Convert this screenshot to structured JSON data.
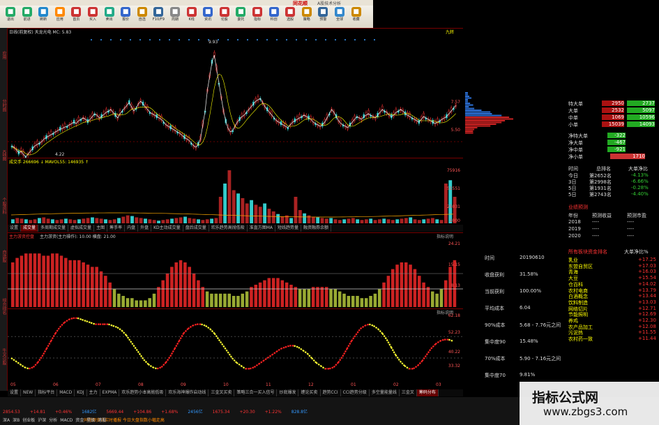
{
  "window": {
    "brand": "同花顺",
    "title": "A股技术分析"
  },
  "toolbar": [
    {
      "icon": "back",
      "label": "退出"
    },
    {
      "icon": "forward",
      "label": "前进"
    },
    {
      "icon": "refresh",
      "label": "刷新"
    },
    {
      "icon": "menu",
      "label": "应用"
    },
    {
      "icon": "home",
      "label": "首页"
    },
    {
      "icon": "buy",
      "label": "买入"
    },
    {
      "icon": "sell",
      "label": "卖出"
    },
    {
      "icon": "quote",
      "label": "报价"
    },
    {
      "icon": "chart",
      "label": "自选"
    },
    {
      "icon": "f10",
      "label": "F10/F9"
    },
    {
      "icon": "bookmark",
      "label": "周期"
    },
    {
      "icon": "kline",
      "label": "K线"
    },
    {
      "icon": "info",
      "label": "资讯"
    },
    {
      "icon": "news",
      "label": "论股"
    },
    {
      "icon": "trade",
      "label": "委托"
    },
    {
      "icon": "data",
      "label": "指标"
    },
    {
      "icon": "tech",
      "label": "科创"
    },
    {
      "icon": "filter",
      "label": "选股"
    },
    {
      "icon": "strategy",
      "label": "策略"
    },
    {
      "icon": "monitor",
      "label": "预警"
    },
    {
      "icon": "global",
      "label": "全球"
    },
    {
      "icon": "favorite",
      "label": "收藏"
    }
  ],
  "left_tabs": [
    "应用",
    "分时图",
    "K线图",
    "个股资料",
    "自选股",
    "综合排名",
    "牛叉诊股"
  ],
  "kline": {
    "header": "日线(前复权)  天龙光电  MC: 5.83",
    "high_label": "9.93",
    "low_label": "4.22",
    "y_labels": [
      "7.57",
      "5.50"
    ],
    "right_tag": "九转"
  },
  "volume": {
    "header": "成交手 266696 ↓  MAVOL55: 146935 ↑",
    "y_labels": [
      "75916",
      "51551",
      "25031",
      "1000"
    ]
  },
  "tabs1": [
    "设置",
    "成交量",
    "多周期成交量",
    "虚拟成交量",
    "主图",
    "筹手率",
    "内盘",
    "外盘",
    "KD主动成交量",
    "盘后成交量",
    "欢乐趋势高抛低吸",
    "准直方图MA",
    "短线趋势量",
    "融资融券余额"
  ],
  "tabs1_active": 1,
  "ind1": {
    "header_red": "主力游资控盘",
    "header_formula": "主力游资(主力操作): 10.00  横盘: 21.00",
    "right_label": "指标说明",
    "y_labels": [
      "24.21",
      "15.15",
      "8.13"
    ],
    "chart_data": {
      "type": "bar",
      "title": "主力游资控盘",
      "ylim": [
        0,
        30
      ],
      "threshold": 8.13,
      "values": [
        20,
        22,
        23,
        24,
        24,
        24,
        24,
        23,
        23,
        24,
        24,
        23,
        22,
        21,
        21,
        21,
        20,
        19,
        18,
        18,
        16,
        14,
        11,
        8,
        6,
        5,
        4,
        4,
        3,
        3,
        3,
        4,
        6,
        9,
        12,
        15,
        18,
        20,
        21,
        20,
        18,
        15,
        12,
        9,
        7,
        6,
        6,
        6,
        6,
        6,
        5,
        5,
        6,
        7,
        9,
        10,
        11,
        12,
        13,
        13,
        13,
        12,
        11,
        10,
        9,
        8,
        8,
        8,
        9,
        9,
        9,
        9,
        8,
        8,
        7,
        6,
        5,
        5,
        5,
        4,
        4,
        5,
        6,
        8,
        11,
        14,
        17,
        19,
        20,
        20,
        19,
        17,
        14,
        11,
        9,
        7,
        6,
        8,
        12,
        18,
        21
      ]
    }
  },
  "ind2": {
    "right_label": "指标说明",
    "y_labels": [
      "62.18",
      "52.23",
      "40.22",
      "33.32"
    ],
    "chart_data": {
      "type": "line",
      "title": "",
      "ylim": [
        25,
        70
      ],
      "values": [
        40,
        38,
        36,
        34,
        33,
        34,
        37,
        41,
        46,
        51,
        56,
        60,
        63,
        65,
        66,
        66,
        65,
        64,
        63,
        62,
        62,
        62,
        62,
        61,
        60,
        58,
        55,
        51,
        47,
        43,
        39,
        36,
        34,
        33,
        34,
        37,
        41,
        46,
        51,
        56,
        59,
        61,
        62,
        62,
        61,
        59,
        56,
        52,
        48,
        44,
        40,
        37,
        35,
        33,
        33,
        34,
        36,
        38,
        40,
        42,
        44,
        46,
        47,
        48,
        48,
        47,
        45,
        43,
        40,
        37,
        35,
        33,
        33,
        34,
        37,
        41,
        46,
        51,
        55,
        59,
        61,
        62,
        61,
        59,
        56,
        52,
        47,
        42,
        38,
        35,
        33,
        33,
        35,
        38,
        42,
        46,
        49,
        51,
        52,
        52,
        51
      ]
    }
  },
  "xaxis": [
    "05",
    "06",
    "07",
    "08",
    "09",
    "10",
    "11",
    "12",
    "01",
    "02",
    "03"
  ],
  "tabs2": [
    "设置",
    "NEW",
    "指标平台",
    "MACD",
    "KDJ",
    "主力",
    "EXPMA",
    "欢乐趋势小本高抛低吸",
    "欢乐海神爆炸启动线",
    "三金叉买卖",
    "策略三合一买入信号",
    "炒底爆发",
    "缠论买卖",
    "趋势CCI",
    "CCI趋势分级",
    "多空量能量线",
    "三金叉",
    "筹码分布"
  ],
  "tabs2_active": 17,
  "subtabs": [
    "个股新闻",
    "个股公告",
    "个股研报",
    "行业资讯",
    "基本面",
    "估值偏差",
    "大单分析",
    "A股期个股",
    "股东类型"
  ],
  "right": {
    "orderflow": [
      {
        "label": "特大单",
        "v1": "2950",
        "v2": "2737",
        "dir": "buy"
      },
      {
        "label": "大单",
        "v1": "2532",
        "v2": "5097",
        "dir": "sell"
      },
      {
        "label": "中单",
        "v1": "1069",
        "v2": "10596",
        "dir": "sell"
      },
      {
        "label": "小单",
        "v1": "15039",
        "v2": "14093",
        "dir": "buy"
      }
    ],
    "netflow": [
      {
        "label": "净特大单",
        "value": "-322"
      },
      {
        "label": "净大单",
        "value": "-467"
      },
      {
        "label": "净中单",
        "value": "-921"
      },
      {
        "label": "净小单",
        "value": "1710"
      }
    ],
    "ranking": {
      "headers": [
        "时间",
        "总排名",
        "大单净比"
      ],
      "rows": [
        {
          "time": "今日",
          "rank": "第2652名",
          "ratio": "-4.13%"
        },
        {
          "time": "3日",
          "rank": "第2998名",
          "ratio": "-6.66%"
        },
        {
          "time": "5日",
          "rank": "第1931名",
          "ratio": "-0.28%"
        },
        {
          "time": "5日",
          "rank": "第2743名",
          "ratio": "-4.40%"
        }
      ]
    },
    "forecast": {
      "title": "业绩预测",
      "headers": [
        "年份",
        "预测收益",
        "预测市盈"
      ],
      "rows": [
        [
          "2018",
          "----",
          "----"
        ],
        [
          "2019",
          "----",
          "----"
        ],
        [
          "2020",
          "----",
          "----"
        ]
      ]
    },
    "chip": {
      "title": "获利比例",
      "rows": [
        {
          "label": "时间",
          "value": "20190610"
        },
        {
          "label": "收盘获利",
          "value": "31.58%"
        },
        {
          "label": "当前获利",
          "value": "100.00%"
        },
        {
          "label": "平均成本",
          "value": "6.04"
        },
        {
          "label": "90%成本",
          "value": "5.68 - 7.76元之间"
        },
        {
          "label": "集中度90",
          "value": "15.48%"
        },
        {
          "label": "70%成本",
          "value": "5.90 - 7.16元之间"
        },
        {
          "label": "集中度70",
          "value": "9.81%"
        }
      ]
    },
    "sectors": {
      "headers": [
        "所有板块资金排名",
        "大单净比%"
      ],
      "rows": [
        {
          "name": "乳业",
          "value": "+17.25"
        },
        {
          "name": "东盟自贸区",
          "value": "+17.03"
        },
        {
          "name": "青海",
          "value": "+16.03"
        },
        {
          "name": "大豆",
          "value": "+15.54"
        },
        {
          "name": "仓百科",
          "value": "+14.02"
        },
        {
          "name": "农村电商",
          "value": "+13.79"
        },
        {
          "name": "白酒概念",
          "value": "+13.44"
        },
        {
          "name": "饮料制造",
          "value": "+13.03"
        },
        {
          "name": "网络切片",
          "value": "+12.71"
        },
        {
          "name": "节能照明",
          "value": "+12.69"
        },
        {
          "name": "养鸡",
          "value": "+12.30"
        },
        {
          "name": "农产品加工",
          "value": "+12.08"
        },
        {
          "name": "污泥热",
          "value": "+11.55"
        },
        {
          "name": "农村药一致",
          "value": "+11.44"
        }
      ]
    }
  },
  "bottombar": {
    "items": [
      "2854.53",
      "+14.81",
      "+0.46%",
      "1682亿",
      "5669.44",
      "+104.86",
      "+1.68%",
      "2456亿",
      "1675.34",
      "+20.30",
      "+1.22%",
      "828.8亿"
    ],
    "ticker": "同花顺资讯实时播报 今日大盘指数小幅走高",
    "menu": [
      "深A",
      "深B",
      "创业板",
      "沪深",
      "分析",
      "MACD",
      "资金",
      "星级",
      "港股"
    ]
  },
  "watermark": {
    "title": "指标公式网",
    "url": "www.zbgs3.com"
  }
}
